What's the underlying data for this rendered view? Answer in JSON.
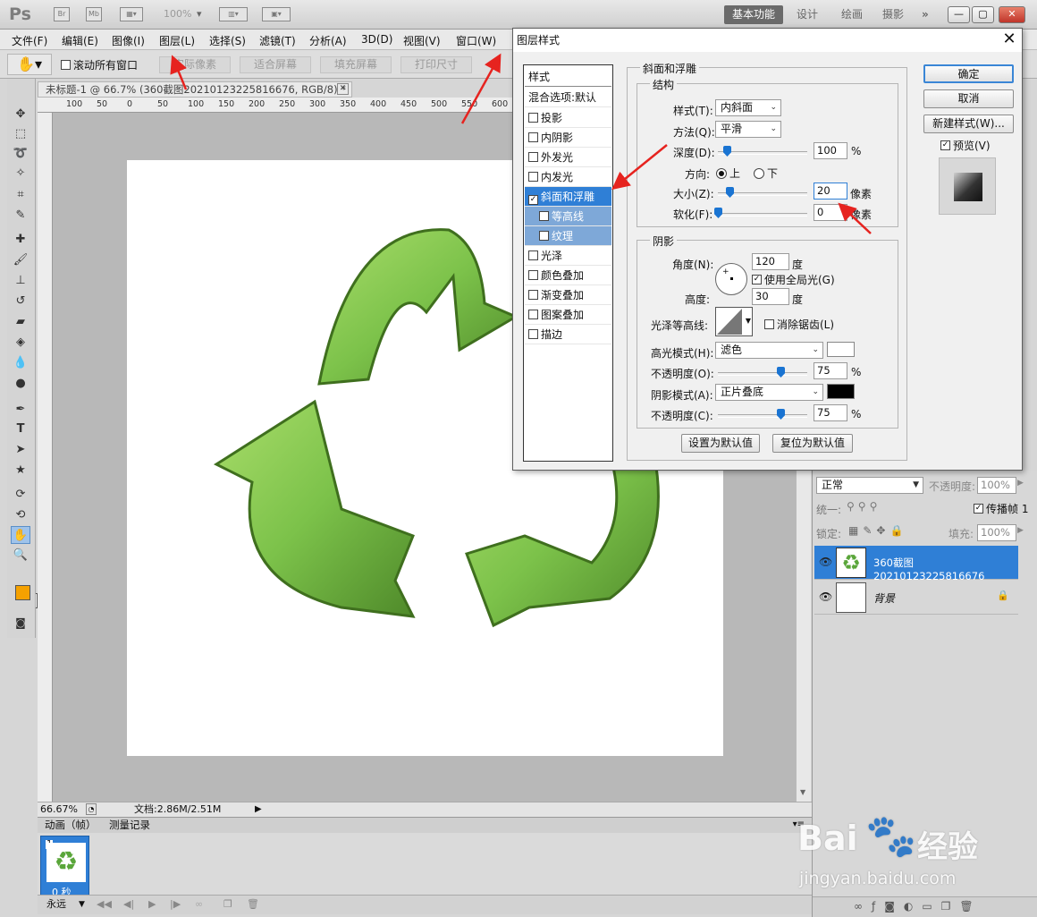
{
  "app": {
    "logo": "Ps",
    "bridge_label": "Br",
    "minibridge_label": "Mb",
    "zoom": "100%",
    "workspaces": [
      "基本功能",
      "设计",
      "绘画",
      "摄影"
    ]
  },
  "menu": [
    "文件(F)",
    "编辑(E)",
    "图像(I)",
    "图层(L)",
    "选择(S)",
    "滤镜(T)",
    "分析(A)",
    "3D(D)",
    "视图(V)",
    "窗口(W)"
  ],
  "options": {
    "scroll_all": "滚动所有窗口",
    "buttons": [
      "实际像素",
      "适合屏幕",
      "填充屏幕",
      "打印尺寸"
    ]
  },
  "document": {
    "tab_title": "未标题-1 @ 66.7% (360截图20210123225816676, RGB/8) *",
    "ruler_h": [
      "100",
      "50",
      "0",
      "50",
      "100",
      "150",
      "200",
      "250",
      "300",
      "350",
      "400",
      "450",
      "500",
      "550",
      "600"
    ],
    "zoom_status": "66.67%",
    "doc_size": "文档:2.86M/2.51M"
  },
  "animation": {
    "tabs": [
      "动画（帧）",
      "测量记录"
    ],
    "frame_number": "1",
    "frame_time": "0 秒",
    "loop": "永远"
  },
  "layers": {
    "blend_mode": "正常",
    "opacity_label": "不透明度:",
    "opacity": "100%",
    "unify_label": "统一:",
    "propagate": "传播帧 1",
    "lock_label": "锁定:",
    "fill_label": "填充:",
    "fill": "100%",
    "items": [
      {
        "name": "360截图20210123225816676",
        "selected": true
      },
      {
        "name": "背景",
        "selected": false
      }
    ]
  },
  "dialog": {
    "title": "图层样式",
    "styles_header": "样式",
    "blend_options": "混合选项:默认",
    "effects": [
      {
        "label": "投影",
        "checked": false,
        "state": "normal"
      },
      {
        "label": "内阴影",
        "checked": false,
        "state": "normal"
      },
      {
        "label": "外发光",
        "checked": false,
        "state": "normal"
      },
      {
        "label": "内发光",
        "checked": false,
        "state": "normal"
      },
      {
        "label": "斜面和浮雕",
        "checked": true,
        "state": "selected"
      },
      {
        "label": "等高线",
        "checked": false,
        "state": "sub"
      },
      {
        "label": "纹理",
        "checked": false,
        "state": "sub"
      },
      {
        "label": "光泽",
        "checked": false,
        "state": "normal"
      },
      {
        "label": "颜色叠加",
        "checked": false,
        "state": "normal"
      },
      {
        "label": "渐变叠加",
        "checked": false,
        "state": "normal"
      },
      {
        "label": "图案叠加",
        "checked": false,
        "state": "normal"
      },
      {
        "label": "描边",
        "checked": false,
        "state": "normal"
      }
    ],
    "bevel": {
      "section": "斜面和浮雕",
      "structure": "结构",
      "style_label": "样式(T):",
      "style": "内斜面",
      "method_label": "方法(Q):",
      "method": "平滑",
      "depth_label": "深度(D):",
      "depth": "100",
      "depth_unit": "%",
      "depth_level": 0.1,
      "direction_label": "方向:",
      "dir_up": "上",
      "dir_down": "下",
      "size_label": "大小(Z):",
      "size": "20",
      "size_unit": "像素",
      "size_level": 0.13,
      "soften_label": "软化(F):",
      "soften": "0",
      "soften_unit": "像素",
      "soften_level": 0.0
    },
    "shading": {
      "section": "阴影",
      "angle_label": "角度(N):",
      "angle": "120",
      "angle_unit": "度",
      "global_light": "使用全局光(G)",
      "altitude_label": "高度:",
      "altitude": "30",
      "altitude_unit": "度",
      "gloss_label": "光泽等高线:",
      "antialias": "消除锯齿(L)",
      "highlight_label": "高光模式(H):",
      "highlight_mode": "滤色",
      "highlight_color": "#ffffff",
      "hl_opacity_label": "不透明度(O):",
      "hl_opacity": "75",
      "hl_opacity_level": 0.7,
      "shadow_label": "阴影模式(A):",
      "shadow_mode": "正片叠底",
      "shadow_color": "#000000",
      "sh_opacity_label": "不透明度(C):",
      "sh_opacity": "75",
      "sh_opacity_level": 0.7,
      "percent": "%"
    },
    "make_default": "设置为默认值",
    "reset_default": "复位为默认值",
    "ok": "确定",
    "cancel": "取消",
    "new_style": "新建样式(W)...",
    "preview": "预览(V)"
  },
  "watermark": {
    "brand": "Bai",
    "brand2": "经验",
    "url": "jingyan.baidu.com"
  },
  "colors": {
    "accent": "#2f7fd6",
    "fg_swatch": "#f5a100",
    "recycle_green": "#7cc24a",
    "annotation_red": "#e6231f"
  }
}
